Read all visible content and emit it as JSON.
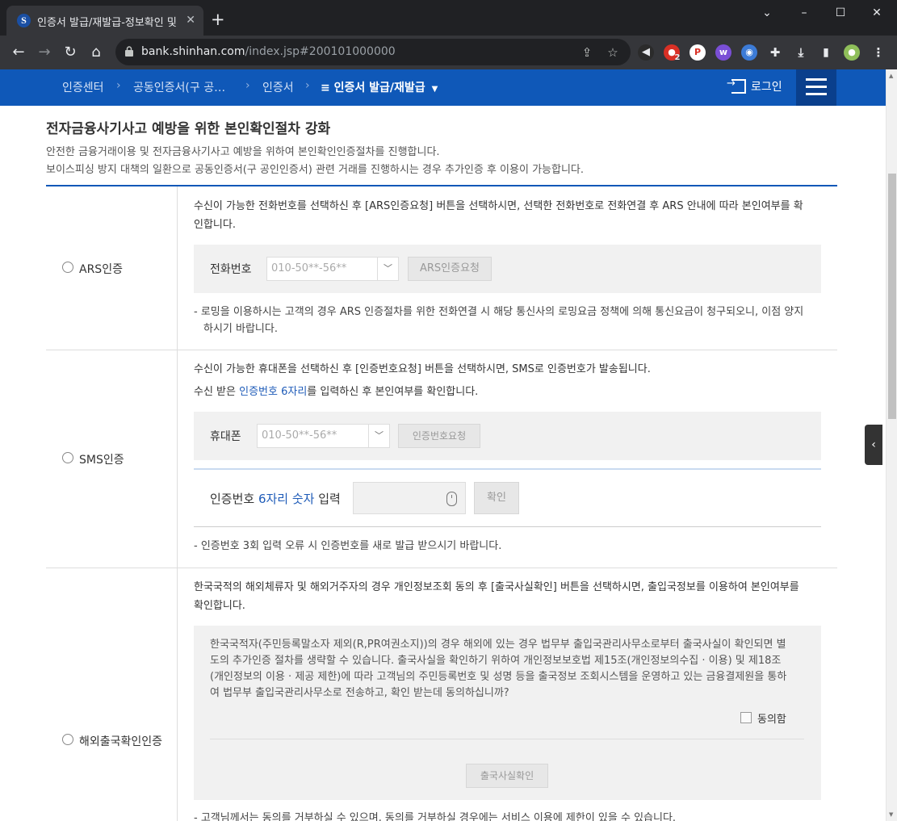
{
  "browser": {
    "tab_title": "인증서 발급/재발급-정보확인 및",
    "tab_close": "✕",
    "new_tab": "+",
    "url_host": "bank.shinhan.com",
    "url_path": "/index.jsp#200101000000",
    "ext_badge": "2"
  },
  "nav": {
    "crumbs": [
      "인증센터",
      "공동인증서(구 공…",
      "인증서"
    ],
    "current": "인증서 발급/재발급",
    "login": "로그인"
  },
  "page": {
    "title": "전자금융사기사고 예방을 위한 본인확인절차 강화",
    "desc1": "안전한 금융거래이용 및 전자금융사기사고 예방을 위하여 본인확인인증절차를 진행합니다.",
    "desc2": "보이스피싱 방지 대책의 일환으로 공동인증서(구 공인인증서) 관련 거래를 진행하시는 경우 추가인증 후 이용이 가능합니다."
  },
  "ars": {
    "label": "ARS인증",
    "desc1": "수신이 가능한 전화번호를 선택하신 후 [ARS인증요청] 버튼을 선택하시면, 선택한 전화번호로 전화연결 후 ARS 안내에 따라 본인여부를 확",
    "desc2": "인합니다.",
    "phone_label": "전화번호",
    "phone_value": "010-50**-56**",
    "request_button": "ARS인증요청",
    "note1": "-  로밍을 이용하시는 고객의 경우 ARS 인증절차를 위한 전화연결 시 해당 통신사의 로밍요금 정책에 의해 통신요금이 청구되오니, 이점 양지",
    "note2": "하시기 바랍니다."
  },
  "sms": {
    "label": "SMS인증",
    "desc1": "수신이 가능한 휴대폰을 선택하신 후 [인증번호요청] 버튼을 선택하시면, SMS로 인증번호가 발송됩니다.",
    "desc2_pre": "수신 받은 ",
    "desc2_blue": "인증번호 6자리",
    "desc2_post": "를 입력하신 후 본인여부를 확인합니다.",
    "phone_label": "휴대폰",
    "phone_value": "010-50**-56**",
    "request_button": "인증번호요청",
    "code_label_pre": "인증번호 ",
    "code_label_blue": "6자리 숫자",
    "code_label_post": " 입력",
    "confirm_button": "확인",
    "note": "-  인증번호 3회 입력 오류 시 인증번호를 새로 발급 받으시기 바랍니다."
  },
  "overseas": {
    "label": "해외출국확인인증",
    "desc1": "한국국적의 해외체류자 및 해외거주자의 경우 개인정보조회 동의 후 [출국사실확인] 버튼을 선택하시면, 출입국정보를 이용하여 본인여부를",
    "desc2": "확인합니다.",
    "consent1": "한국국적자(주민등록말소자 제외(R,PR여권소지))의 경우 해외에 있는 경우 법무부 출입국관리사무소로부터 출국사실이 확인되면 별",
    "consent2": "도의 추가인증 절차를 생략할 수 있습니다. 출국사실을 확인하기 위하여 개인정보보호법 제15조(개인정보의수집 · 이용) 및 제18조",
    "consent3": "(개인정보의 이용 · 제공 제한)에 따라 고객님의 주민등록번호 및 성명 등을 출국정보 조회시스템을 운영하고 있는 금융결제원을 통하",
    "consent4": "여 법무부 출입국관리사무소로 전송하고, 확인 받는데 동의하십니까?",
    "agree_label": "동의함",
    "confirm_button": "출국사실확인",
    "note": "-  고객님께서는 동의를 거부하실 수 있으며, 동의를 거부하실 경우에는 서비스 이용에 제한이 있을 수 있습니다."
  }
}
